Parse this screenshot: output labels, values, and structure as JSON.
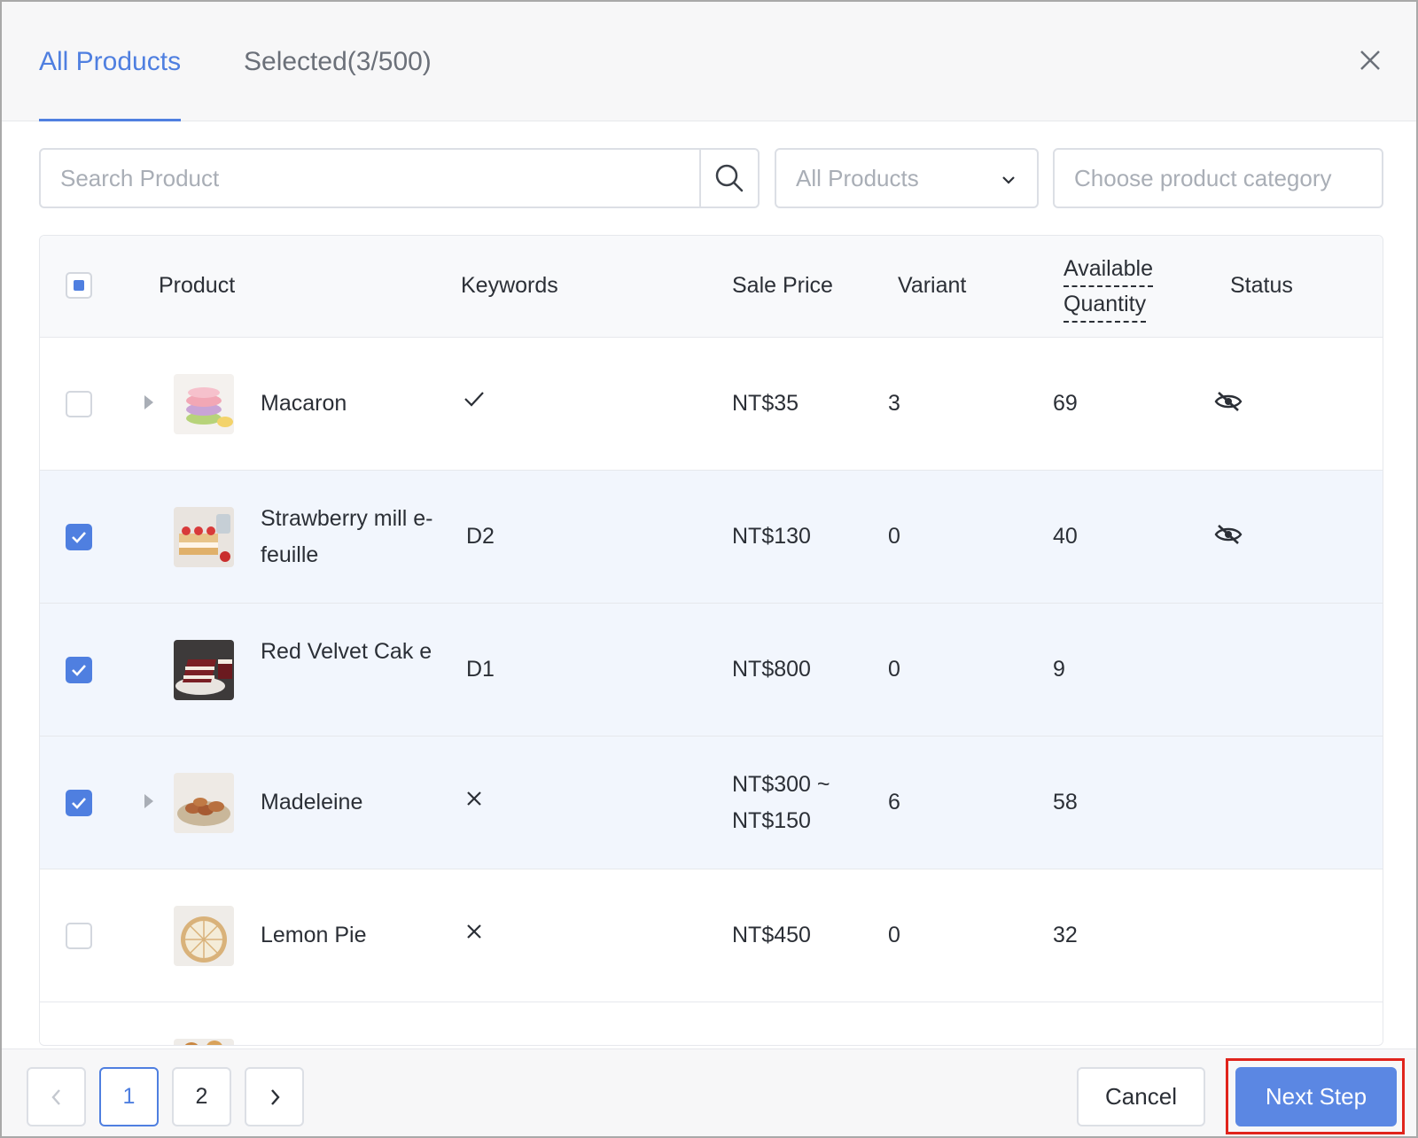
{
  "tabs": {
    "all_label": "All Products",
    "selected_label": "Selected(3/500)"
  },
  "filters": {
    "search_placeholder": "Search Product",
    "product_filter_value": "All Products",
    "category_placeholder": "Choose product category"
  },
  "table": {
    "headers": {
      "product": "Product",
      "keywords": "Keywords",
      "sale_price": "Sale Price",
      "variant": "Variant",
      "available_line1": "Available",
      "available_line2": "Quantity",
      "status": "Status"
    },
    "rows": [
      {
        "name": "Macaron",
        "keyword": "",
        "keyword_icon": "check-icon",
        "price": "NT$35",
        "variant": "3",
        "quantity": "69",
        "status_icon": "eye-off-icon",
        "selected": false,
        "expandable": true
      },
      {
        "name": "Strawberry mill e-feuille",
        "keyword": "D2",
        "keyword_icon": "",
        "price": "NT$130",
        "variant": "0",
        "quantity": "40",
        "status_icon": "eye-off-icon",
        "selected": true,
        "expandable": false
      },
      {
        "name": "Red Velvet Cak e",
        "keyword": "D1",
        "keyword_icon": "",
        "price": "NT$800",
        "variant": "0",
        "quantity": "9",
        "status_icon": "",
        "selected": true,
        "expandable": false
      },
      {
        "name": "Madeleine",
        "keyword": "",
        "keyword_icon": "cross-icon",
        "price": "NT$300 ~ NT$150",
        "variant": "6",
        "quantity": "58",
        "status_icon": "",
        "selected": true,
        "expandable": true
      },
      {
        "name": "Lemon Pie",
        "keyword": "",
        "keyword_icon": "cross-icon",
        "price": "NT$450",
        "variant": "0",
        "quantity": "32",
        "status_icon": "",
        "selected": false,
        "expandable": false
      }
    ]
  },
  "pagination": {
    "page1": "1",
    "page2": "2",
    "current_page": 1
  },
  "footer": {
    "cancel_label": "Cancel",
    "next_label": "Next Step"
  },
  "colors": {
    "accent": "#4f7fe0",
    "primary_button": "#5b87e3",
    "highlight_box": "#e0241c"
  }
}
